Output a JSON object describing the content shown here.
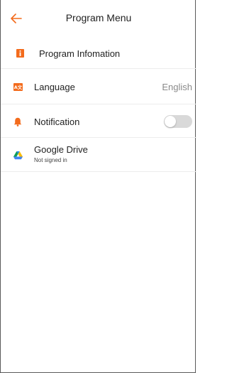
{
  "header": {
    "title": "Program Menu",
    "back_icon": "arrow-left-icon"
  },
  "colors": {
    "accent": "#f36b1c",
    "toggle_off": "#d9d9d9",
    "secondary_text": "#8a8a8a"
  },
  "menu": {
    "program_info": {
      "label": "Program Infomation",
      "icon": "info-icon"
    },
    "language": {
      "label": "Language",
      "value": "English",
      "icon": "translate-icon"
    },
    "notification": {
      "label": "Notification",
      "enabled": false,
      "icon": "bell-icon"
    },
    "google_drive": {
      "label": "Google Drive",
      "status": "Not signed in",
      "icon": "google-drive-icon"
    }
  }
}
